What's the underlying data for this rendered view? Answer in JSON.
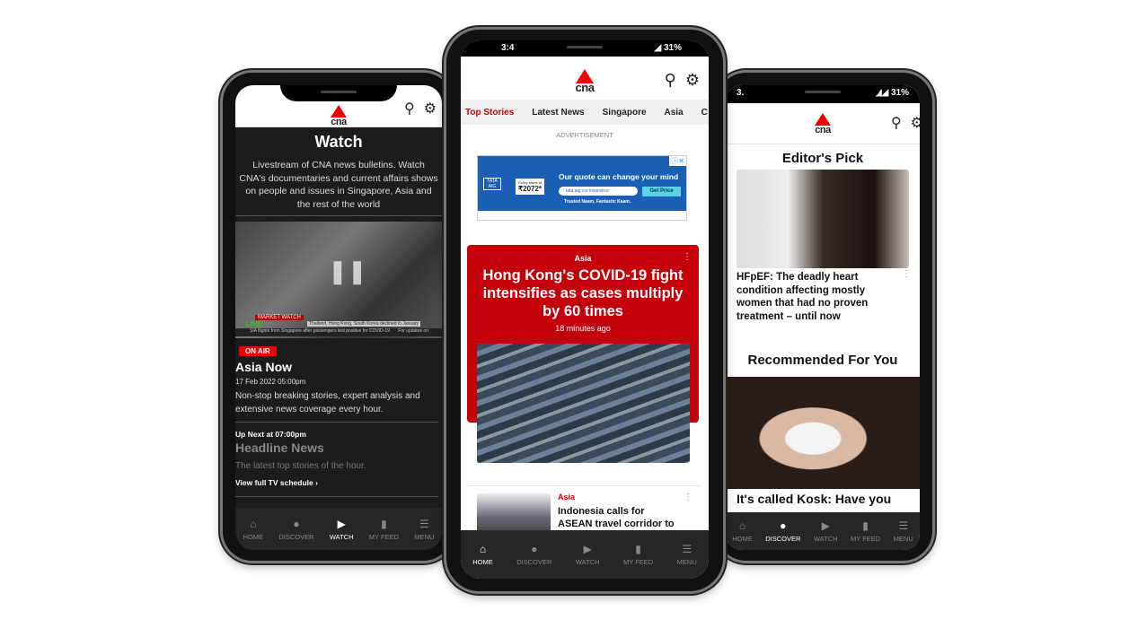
{
  "brand": {
    "logo": "cna",
    "red": "#e00000"
  },
  "header_icons": [
    "search-icon",
    "gear-icon"
  ],
  "nav": [
    {
      "label": "HOME",
      "icon": "home-icon"
    },
    {
      "label": "DISCOVER",
      "icon": "compass-icon"
    },
    {
      "label": "WATCH",
      "icon": "play-icon"
    },
    {
      "label": "MY FEED",
      "icon": "bookmark-icon"
    },
    {
      "label": "MENU",
      "icon": "menu-icon"
    }
  ],
  "left": {
    "title": "Watch",
    "description": "Livestream of CNA news bulletins. Watch CNA's documentaries and current affairs shows on people and issues in Singapore, Asia and the rest of the world",
    "video": {
      "tag": "MARKET WATCH",
      "live": "LIVE",
      "ticker1": "Thailand, Hong Kong, South Korea declined in January",
      "ticker2": "SIA flights from Singapore after passengers test positive for COVID-19",
      "ticker3": "For updates on"
    },
    "badge": "ON AIR",
    "show": "Asia Now",
    "datetime": "17 Feb 2022 05:00pm",
    "show_desc": "Non-stop breaking stories, expert analysis and extensive news coverage every hour.",
    "up_next": "Up Next at 07:00pm",
    "next_show": "Headline News",
    "next_desc": "The latest top stories of the hour.",
    "schedule_link": "View full TV schedule"
  },
  "middle": {
    "status": {
      "time": "3:4",
      "battery": "31%"
    },
    "tabs": [
      "Top Stories",
      "Latest News",
      "Singapore",
      "Asia",
      "C"
    ],
    "ad_label": "ADVERTISEMENT",
    "ad": {
      "brand": "TATA AIG",
      "price_label": "Policy starts at",
      "price": "₹2072*",
      "headline": "Our quote can change your mind",
      "search": "tata aig car insurance",
      "cta": "Get Price",
      "tagline": "Trusted Naam, Fantastic Kaam."
    },
    "featured": {
      "category": "Asia",
      "title": "Hong Kong's COVID-19 fight intensifies as cases multiply by 60 times",
      "time": "18 minutes ago"
    },
    "story": {
      "category": "Asia",
      "title": "Indonesia calls for ASEAN travel corridor to be"
    }
  },
  "right": {
    "status": {
      "time": "3.",
      "battery": "31%"
    },
    "editors_pick": "Editor's Pick",
    "pick_title": "HFpEF: The deadly heart condition affecting mostly women that had no proven treatment – until now",
    "recommended": "Recommended For You",
    "rec_title": "It's called Kosk: Have you"
  }
}
